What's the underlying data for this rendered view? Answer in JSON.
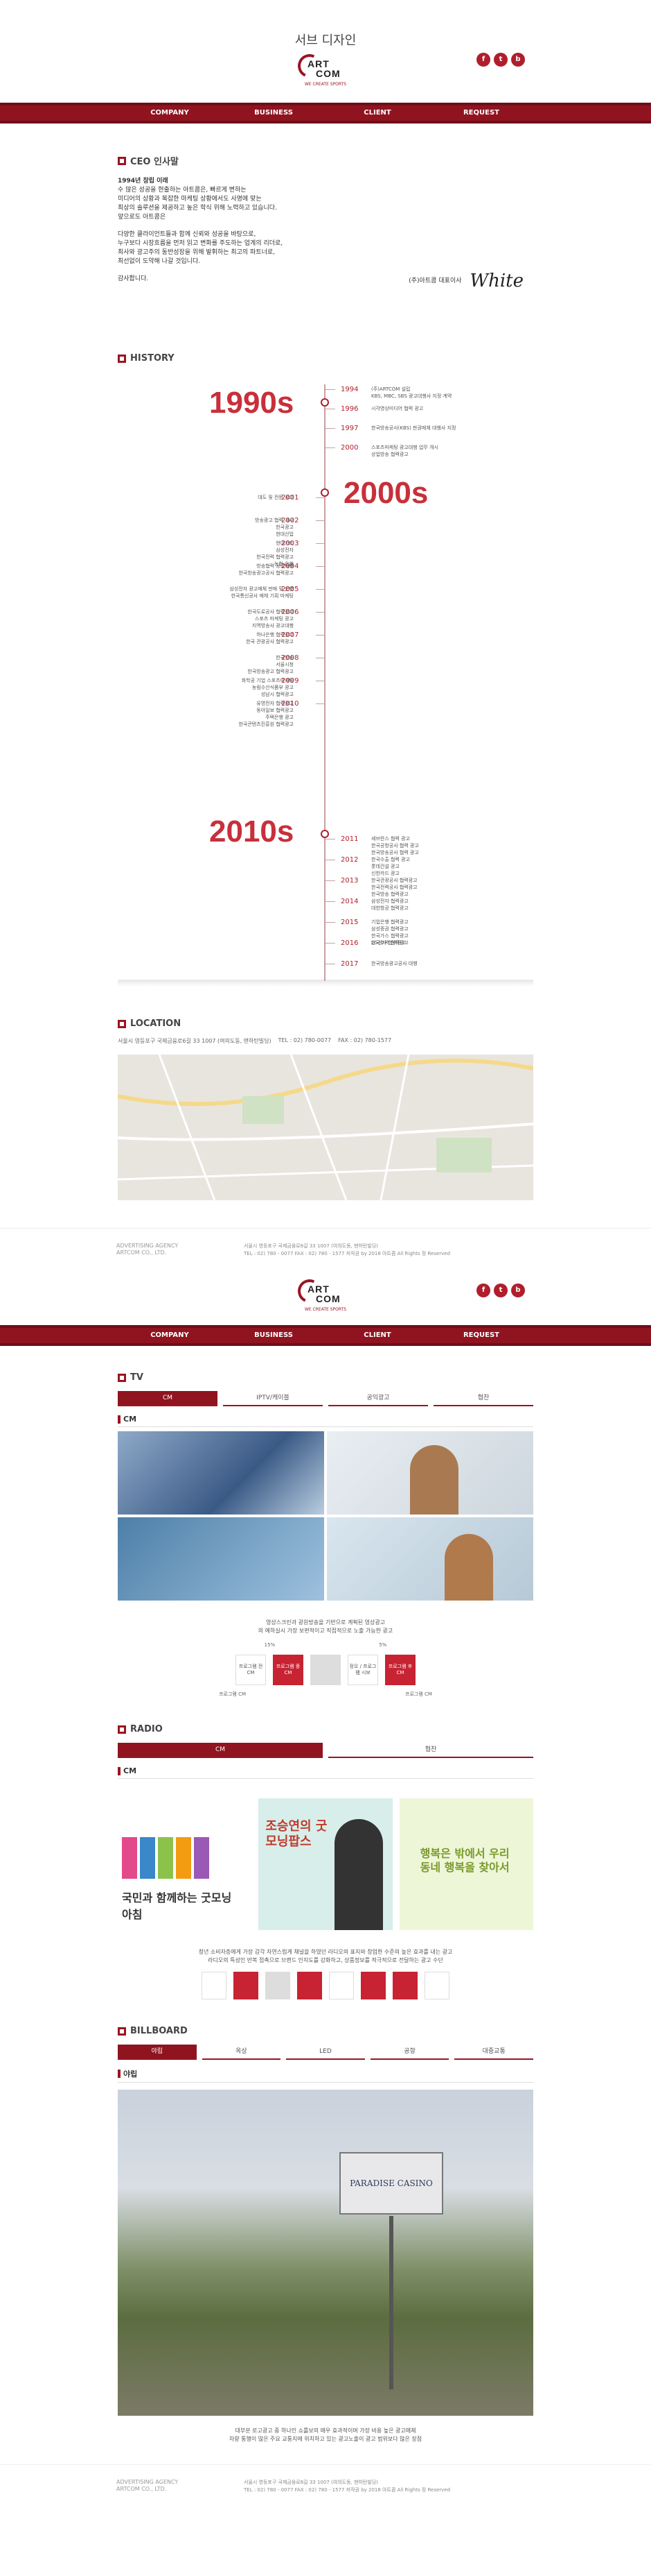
{
  "header": {
    "page_title": "서브 디자인",
    "logo_line1": "ART",
    "logo_line2": "COM",
    "logo_sub": "WE CREATE SPORTS",
    "sns": [
      "f",
      "t",
      "b"
    ]
  },
  "nav": [
    "COMPANY",
    "BUSINESS",
    "CLIENT",
    "REQUEST"
  ],
  "ceo": {
    "heading": "CEO 인사말",
    "bold": "1994년 창립 이래",
    "lines": [
      "수 많은 성공을 현출하는 아트콤은, 빠르게 변하는",
      "미디어의 상황과 복잡한 마케팅 상황에서도 사명에 맞는",
      "최상의 솔루션을 제공하고 높은 학식 위해 노력하고 있습니다.",
      "앞으로도 아트콤은"
    ],
    "lines2": [
      "다양한 클라이언트들과 함께 신뢰와 성공을 바탕으로,",
      "누구보다 시장흐름을 먼저 읽고 변화를 주도하는 업계의 리더로,",
      "최사와 광고주의 동반성장을 위해 발휘하는 최고의 파트너로,",
      "최선없이 도약해 나갈 것입니다."
    ],
    "thanks": "감사합니다.",
    "sign_label": "(주)아트콤 대표이사",
    "signature": "White"
  },
  "history": {
    "heading": "HISTORY",
    "d1": "1990s",
    "d2": "2000s",
    "d3": "2010s",
    "y90": [
      {
        "y": "1994",
        "t": "(주)ARTCOM 설립\nKBS, MBC, SBS 광고대행사 지정 계약"
      },
      {
        "y": "1996",
        "t": "시각영상미디어 협력 광고"
      },
      {
        "y": "1997",
        "t": "한국방송공사(KBS) 판권매체 대행사 지정"
      },
      {
        "y": "2000",
        "t": "스포츠마케팅 광고대행 업무 개시\n상업방송 협력광고"
      }
    ],
    "y00": [
      {
        "y": "2001",
        "t": "대도 및 전문 광고"
      },
      {
        "y": "2002",
        "t": "방송광고 협력 개시\n한국광고\n현대산업"
      },
      {
        "y": "2003",
        "t": "현대카드\n삼성전자\n한국전력 협력광고\n농협 은행"
      },
      {
        "y": "2004",
        "t": "방송협력 광고대행\n한국방송광고공사 협력광고"
      },
      {
        "y": "2005",
        "t": "삼성전자 광고매체 판매 및 운영\n한국통신공사 매체 기획 마케팅"
      },
      {
        "y": "2006",
        "t": "한국도로공사 협력광고\n스포츠 마케팅 광고\n지역방송사 광고대행"
      },
      {
        "y": "2007",
        "t": "하나은행 협력광고\n한국 관광공사 협력광고"
      },
      {
        "y": "2008",
        "t": "한국방송\n서울시청\n한국방송광고 협력광고"
      },
      {
        "y": "2009",
        "t": "화학공 기업 스포츠마케팅\n농림수산식품부 광고\n성남시 협력광고"
      },
      {
        "y": "2010",
        "t": "유명전자 협력광고\n동아일보 협력광고\n주택은행 광고\n한국콘텐츠진흥원 협력광고"
      }
    ],
    "y10": [
      {
        "y": "2011",
        "t": "세브란스 협력 광고\n한국공항공사 협력 광고\n한국방송공사 협력 광고"
      },
      {
        "y": "2012",
        "t": "한국수출 협력 광고\n롯데건설 광고\n신한카드 광고"
      },
      {
        "y": "2013",
        "t": "한국관광공사 협력광고\n한국전력공사 협력광고\n한국방송 협력광고"
      },
      {
        "y": "2014",
        "t": "삼성전자 협력광고\n대한항공 협력광고"
      },
      {
        "y": "2015",
        "t": "기업은행 협력광고\n삼성증권 협력광고\n한국가스 협력광고\n한국수력 협력광고"
      },
      {
        "y": "2016",
        "t": "LG전자 협력광고"
      },
      {
        "y": "2017",
        "t": "한국방송광고공사 대행"
      }
    ]
  },
  "location": {
    "heading": "LOCATION",
    "address": "서울시 영등포구 국제금융로6길 33 1007 (여의도동, 맨하탄빌딩)",
    "tel": "TEL : 02) 780-0077",
    "fax": "FAX : 02) 780-1577"
  },
  "footer": {
    "agency": "ADVERTISING AGENCY",
    "corp": "ARTCOM CO., LTD.",
    "addr": "서울시 영등포구 국제금융로6길 33 1007 (여의도동, 맨하탄빌딩)",
    "contact": "TEL : 02) 780 - 0077 FAX : 02) 780 - 1577 저작권 by 2018 아트콤 All Rights 정 Reserved"
  },
  "tv": {
    "heading": "TV",
    "tabs": [
      "CM",
      "IPTV/케이블",
      "공익광고",
      "협찬"
    ],
    "sub": "CM",
    "desc1": "영상스크린과 광원방송을 기반으로 계획된 영상광고",
    "desc2": "의 예하실시 가장 보편적이고 직접적으로 노출 가능한 광고",
    "bars": [
      "프로그램 전CM",
      "프로그램 중 CM",
      "",
      "정오 / 프로그램 시보",
      "프로그램 후 CM"
    ],
    "notes": [
      "15%",
      "5%"
    ],
    "foot1": "프로그램 CM",
    "foot2": "프로그램 CM"
  },
  "radio": {
    "heading": "RADIO",
    "tabs": [
      "CM",
      "협찬"
    ],
    "sub": "CM",
    "img1": "국민과 함께하는 굿모닝 아침",
    "img2": "조승연의 굿모닝팝스",
    "img3": "행복은 밖에서 우리 동네 행복을 찾아서",
    "desc1": "청년 소비자층에게 가장 감각 자연스럽게 채널을 하였던 라디오의 표지와 창업한 수준의 높은 효과를 내는 광고",
    "desc2": "라디오의 특성인 반복 접촉으로 브랜드 인지도를 강화하고, 상품정보를 적극적으로 전달하는 광고 수단"
  },
  "billboard": {
    "heading": "BILLBOARD",
    "tabs": [
      "야립",
      "옥상",
      "LED",
      "공항",
      "대중교통"
    ],
    "sub": "야립",
    "sign": "PARADISE CASINO",
    "desc1": "대부분 로고광고 중 하나인 쇼를보의 매우 효과적이며 가장 비용 높은 광고매체",
    "desc2": "차량 통행이 많은 주요 교통지에 위치하고 있는 광고노출이 광고 범위보다 많은 장점"
  }
}
